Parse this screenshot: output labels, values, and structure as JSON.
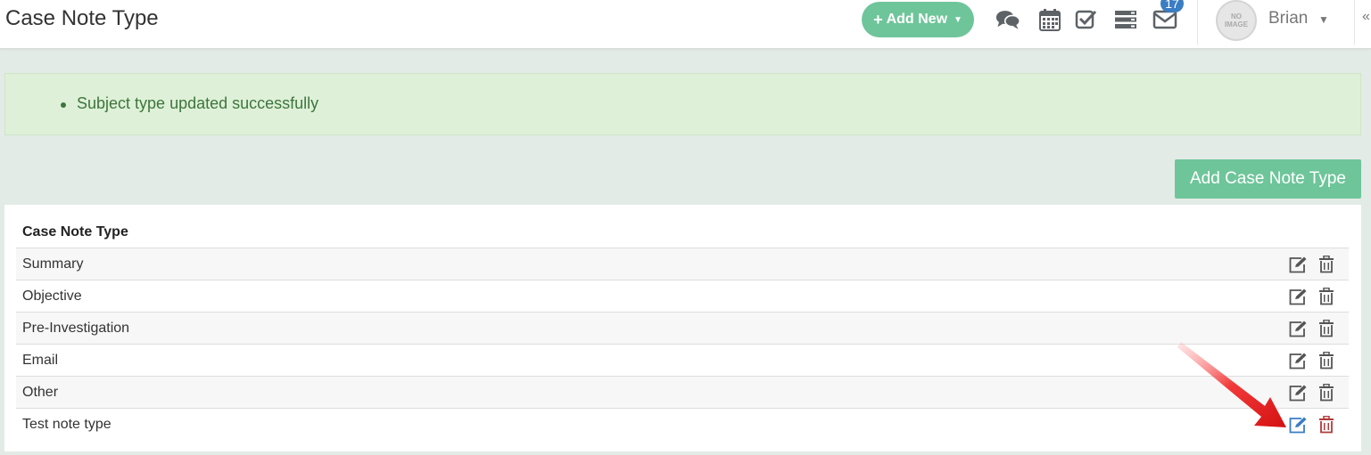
{
  "header": {
    "title": "Case Note Type",
    "add_new_label": "Add New",
    "notification_count": "17",
    "user_name": "Brian",
    "avatar_text_1": "NO",
    "avatar_text_2": "IMAGE",
    "icons": [
      "chat-icon",
      "calendar-icon",
      "tasks-icon",
      "list-icon",
      "mail-icon"
    ]
  },
  "alert": {
    "message": "Subject type updated successfully"
  },
  "actions": {
    "add_type_label": "Add Case Note Type"
  },
  "table": {
    "header": "Case Note Type",
    "rows": [
      "Summary",
      "Objective",
      "Pre-Investigation",
      "Email",
      "Other",
      "Test note type"
    ]
  },
  "colors": {
    "accent_green": "#6ec59a",
    "alert_bg": "#dff0d8",
    "badge_blue": "#3a7dc3",
    "highlight_edit": "#3a7dc3",
    "highlight_delete": "#b03a3a",
    "arrow_red": "#e21b1b"
  }
}
